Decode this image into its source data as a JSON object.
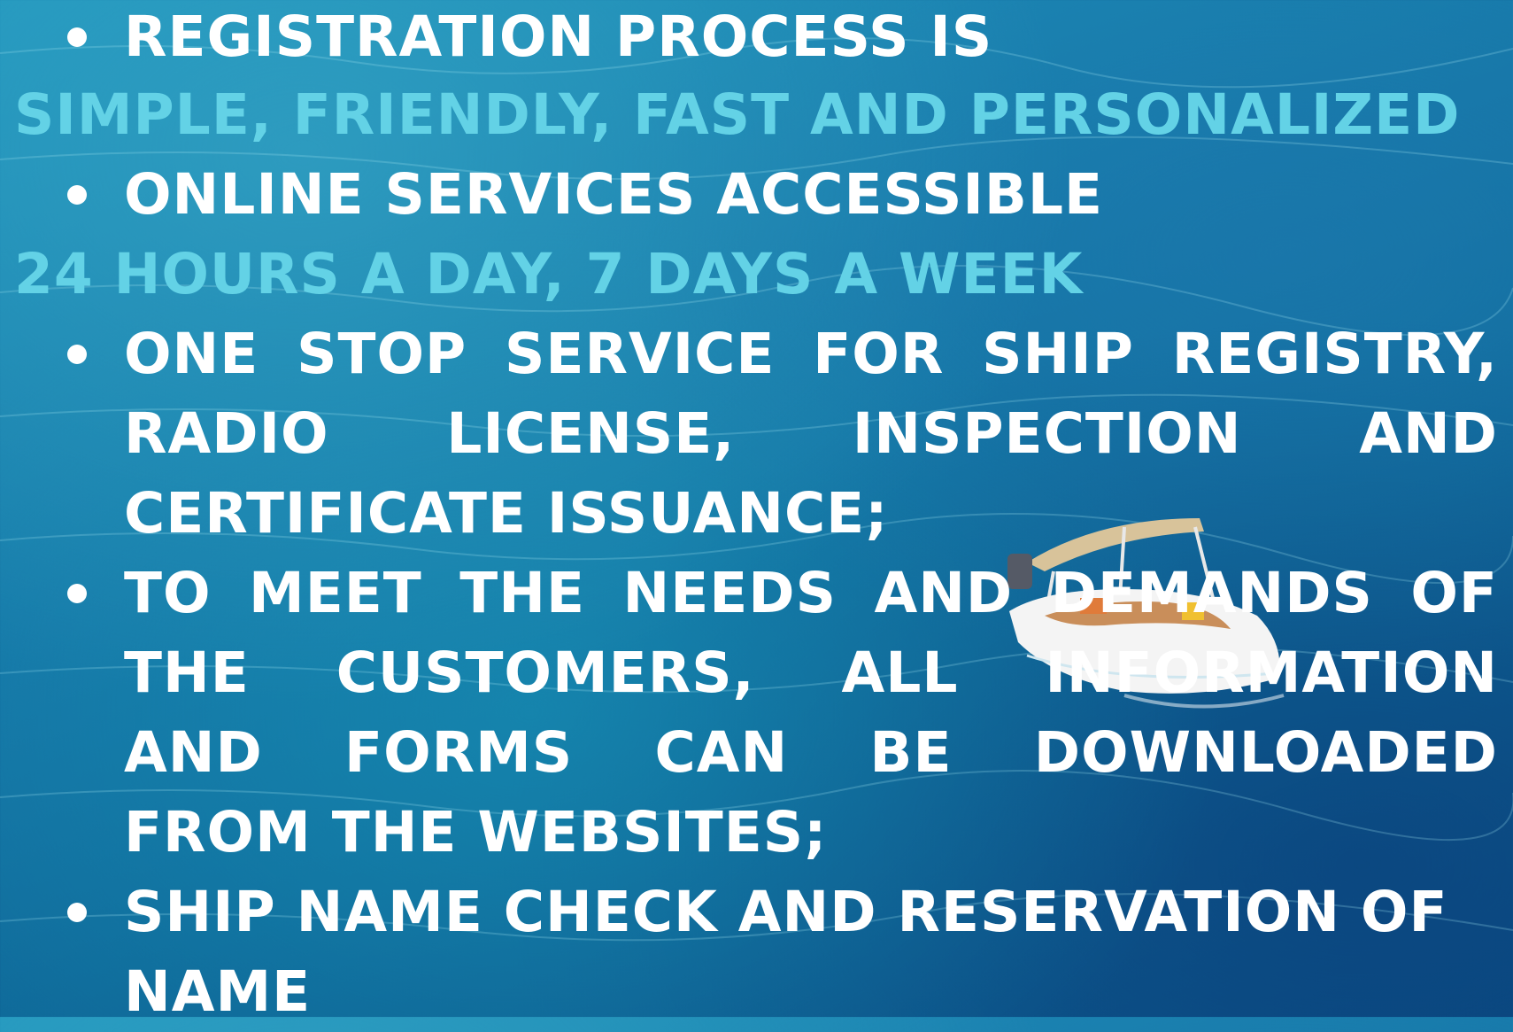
{
  "items": [
    {
      "bullet_lines": [
        "REGISTRATION PROCESS IS"
      ],
      "sub": "SIMPLE, FRIENDLY, FAST AND PERSONALIZED"
    },
    {
      "bullet_lines": [
        "ONLINE SERVICES ACCESSIBLE"
      ],
      "sub": "24 HOURS A DAY, 7 DAYS A WEEK"
    },
    {
      "lines": [
        "ONE",
        "STOP",
        "SERVICE",
        "FOR",
        "SHIP",
        "REGISTRY,",
        "RADIO",
        "LICENSE,",
        "INSPECTION",
        "AND",
        "CERTIFICATE ISSUANCE;"
      ]
    },
    {
      "words": [
        "TO",
        "MEET",
        "THE",
        "NEEDS",
        "AND",
        "DEMANDS",
        "OF",
        "THE",
        "CUSTOMERS,",
        "ALL",
        "INFORMATION",
        "AND",
        "FORMS",
        "CAN",
        "BE",
        "DOWNLOADED",
        "FROM THE WEBSITES;"
      ]
    },
    {
      "lines": [
        "SHIP NAME CHECK AND RESERVATION OF",
        "NAME"
      ]
    }
  ],
  "colors": {
    "text": "#ffffff",
    "accent": "#63d2e6",
    "water": "#1678a8"
  }
}
